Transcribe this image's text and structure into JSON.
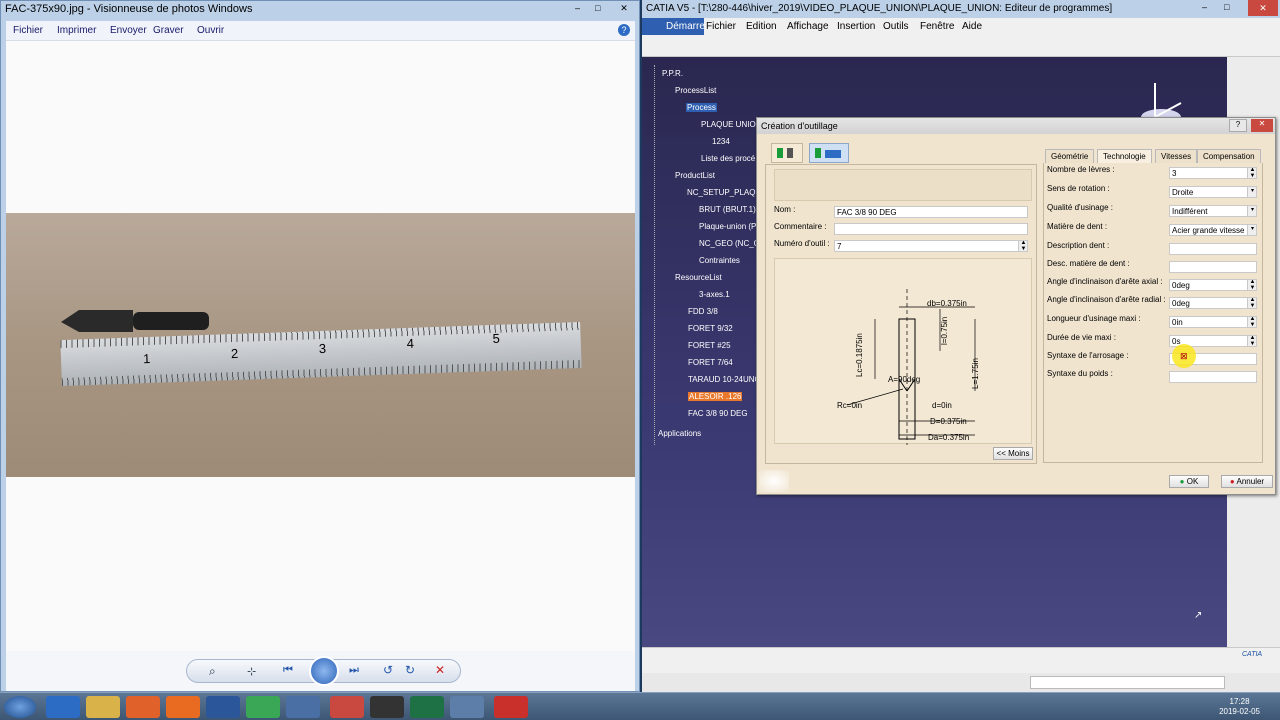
{
  "photo_viewer": {
    "title": "FAC-375x90.jpg - Visionneuse de photos Windows",
    "menu": [
      "Fichier",
      "Imprimer",
      "Envoyer",
      "Graver",
      "Ouvrir"
    ],
    "ruler_numbers": [
      "1",
      "2",
      "3",
      "4",
      "5"
    ]
  },
  "catia": {
    "title": "CATIA V5 - [T:\\280-446\\hiver_2019\\VIDEO_PLAQUE_UNION\\PLAQUE_UNION: Editeur de programmes]",
    "menu": [
      "Démarrer",
      "Fichier",
      "Edition",
      "Affichage",
      "Insertion",
      "Outils",
      "Fenêtre",
      "Aide"
    ],
    "tree": {
      "root": "P.P.R.",
      "process_list": "ProcessList",
      "process": "Process",
      "plaque": "PLAQUE UNION",
      "n1234": "1234",
      "liste": "Liste des procé",
      "product_list": "ProductList",
      "setup": "NC_SETUP_PLAQUE",
      "brut": "BRUT (BRUT.1)",
      "plaque2": "Plaque-union (P",
      "geo": "NC_GEO (NC_GE",
      "contraintes": "Contraintes",
      "resource_list": "ResourceList",
      "axes": "3-axes.1",
      "fdd": "FDD 3/8",
      "foret932": "FORET 9/32",
      "foret25": "FORET #25",
      "foret764": "FORET 7/64",
      "taraud": "TARAUD 10-24UNC",
      "alesoir": "ALESOIR .126",
      "fac": "FAC 3/8 90 DEG",
      "applications": "Applications"
    },
    "brand": "CATIA"
  },
  "dialog": {
    "title": "Création d'outillage",
    "nom_label": "Nom :",
    "nom_value": "FAC 3/8 90 DEG",
    "commentaire_label": "Commentaire :",
    "numero_label": "Numéro d'outil :",
    "numero_value": "7",
    "diagram": {
      "db": "db=0.375in",
      "lc": "Lc=0.1875in",
      "l075": "l=0.75in",
      "l175": "L=1.75in",
      "a": "A=90deg",
      "rc": "Rc=0in",
      "d": "d=0in",
      "D": "D=0.375in",
      "Da": "Da=0.375in"
    },
    "moins_button": "<< Moins",
    "tabs": [
      "Géométrie",
      "Technologie",
      "Vitesses",
      "Compensation"
    ],
    "fields": {
      "nb_levres": {
        "label": "Nombre de lèvres :",
        "value": "3"
      },
      "sens": {
        "label": "Sens de rotation :",
        "value": "Droite"
      },
      "qualite": {
        "label": "Qualité d'usinage :",
        "value": "Indifférent"
      },
      "matiere": {
        "label": "Matière de dent :",
        "value": "Acier grande vitesse"
      },
      "desc_dent": {
        "label": "Description dent :",
        "value": ""
      },
      "desc_mat": {
        "label": "Desc. matière de dent :",
        "value": ""
      },
      "angle_axial": {
        "label": "Angle d'inclinaison d'arête axial :",
        "value": "0deg"
      },
      "angle_radial": {
        "label": "Angle d'inclinaison d'arête radial :",
        "value": "0deg"
      },
      "longueur": {
        "label": "Longueur d'usinage maxi :",
        "value": "0in"
      },
      "duree": {
        "label": "Durée de vie maxi :",
        "value": "0s"
      },
      "arrosage": {
        "label": "Syntaxe de l'arrosage :",
        "value": ""
      },
      "poids": {
        "label": "Syntaxe du poids :",
        "value": ""
      }
    },
    "ok": "OK",
    "annuler": "Annuler"
  },
  "taskbar": {
    "time": "17:28",
    "date": "2019-02-05"
  }
}
